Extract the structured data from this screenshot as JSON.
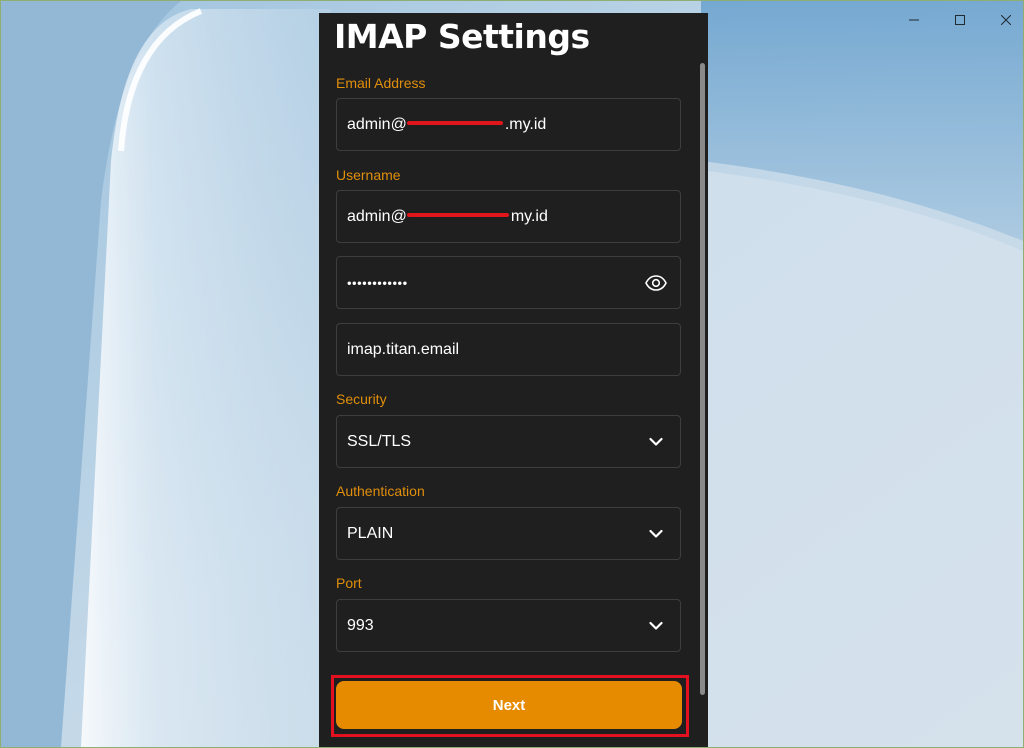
{
  "window": {
    "controls": [
      {
        "name": "minimize",
        "icon": "minimize-icon"
      },
      {
        "name": "maximize",
        "icon": "maximize-icon"
      },
      {
        "name": "close",
        "icon": "close-icon"
      }
    ]
  },
  "form": {
    "title": "IMAP Settings",
    "email": {
      "label": "Email Address",
      "value_prefix": "admin@",
      "value_suffix": ".my.id"
    },
    "username": {
      "label": "Username",
      "value_prefix": "admin@",
      "value_suffix": "my.id"
    },
    "password": {
      "value": "••••••••••••",
      "toggle_icon": "eye-icon"
    },
    "server": {
      "value": "imap.titan.email"
    },
    "security": {
      "label": "Security",
      "value": "SSL/TLS"
    },
    "authentication": {
      "label": "Authentication",
      "value": "PLAIN"
    },
    "port": {
      "label": "Port",
      "value": "993"
    },
    "next_label": "Next"
  },
  "colors": {
    "accent": "#e68a00",
    "label": "#e08e0b",
    "panel_bg": "#1f1f1f",
    "highlight": "#e3101f",
    "redaction": "#e0161b"
  }
}
